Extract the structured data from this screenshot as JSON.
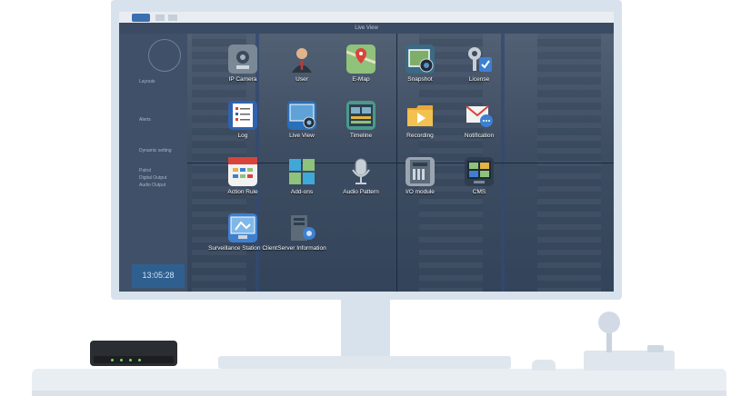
{
  "window": {
    "title": "Live View"
  },
  "sidebar": {
    "items": [
      {
        "label": "Layouts"
      },
      {
        "label": "Alerts"
      },
      {
        "label": "Dynamic setting"
      },
      {
        "label": "Patrol"
      },
      {
        "label": "Digital Output"
      },
      {
        "label": "Audio Output"
      }
    ],
    "clock": "13:05:28"
  },
  "apps": [
    {
      "label": "IP Camera",
      "icon": "ip-camera-icon"
    },
    {
      "label": "User",
      "icon": "user-icon"
    },
    {
      "label": "E-Map",
      "icon": "e-map-icon"
    },
    {
      "label": "Snapshot",
      "icon": "snapshot-icon"
    },
    {
      "label": "License",
      "icon": "license-icon"
    },
    {
      "label": "Log",
      "icon": "log-icon"
    },
    {
      "label": "Live View",
      "icon": "live-view-icon"
    },
    {
      "label": "Timeline",
      "icon": "timeline-icon"
    },
    {
      "label": "Recording",
      "icon": "recording-icon"
    },
    {
      "label": "Notification",
      "icon": "notification-icon"
    },
    {
      "label": "Action Rule",
      "icon": "action-rule-icon"
    },
    {
      "label": "Add-ons",
      "icon": "add-ons-icon"
    },
    {
      "label": "Audio Pattern",
      "icon": "audio-pattern-icon"
    },
    {
      "label": "I/O module",
      "icon": "io-module-icon"
    },
    {
      "label": "CMS",
      "icon": "cms-icon"
    },
    {
      "label": "Surveillance Station Client",
      "icon": "surveillance-client-icon"
    },
    {
      "label": "Server Information",
      "icon": "server-information-icon"
    }
  ],
  "colors": {
    "accent": "#3b6fb2",
    "screen_bg": "#2b3b52"
  }
}
